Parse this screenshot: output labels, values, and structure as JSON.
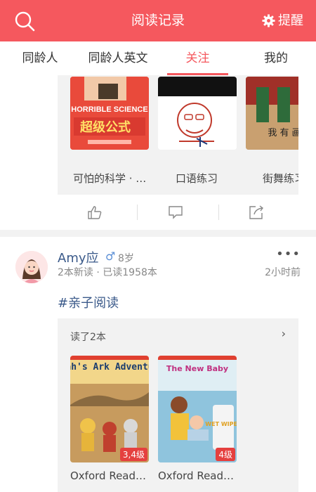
{
  "header": {
    "title": "阅读记录",
    "remind_label": "提醒"
  },
  "tabs": [
    {
      "label": "同龄人"
    },
    {
      "label": "同龄人英文"
    },
    {
      "label": "关注"
    },
    {
      "label": "我的"
    }
  ],
  "card1": {
    "books": [
      {
        "cover_title": "HORRIBLE SCIENCE",
        "cover_sub": "超级公式",
        "label": "可怕的科学 · …"
      },
      {
        "label": "口语练习"
      },
      {
        "cover_text": "我 有 画",
        "label": "街舞练习"
      }
    ]
  },
  "card2": {
    "username": "Amy应",
    "gender_symbol": "♂",
    "age": "8岁",
    "stats": "2本新读 · 已读1958本",
    "time": "2小时前",
    "more": "•••",
    "hashtag": "#亲子阅读",
    "read_label": "读了2本",
    "books": [
      {
        "cover_title": "Noah's Ark Adventure",
        "level": "3,4级",
        "label": "Oxford Read…"
      },
      {
        "cover_title": "The New Baby",
        "cover_sub": "WET WIPES",
        "level": "4级",
        "label": "Oxford Read…"
      }
    ]
  }
}
